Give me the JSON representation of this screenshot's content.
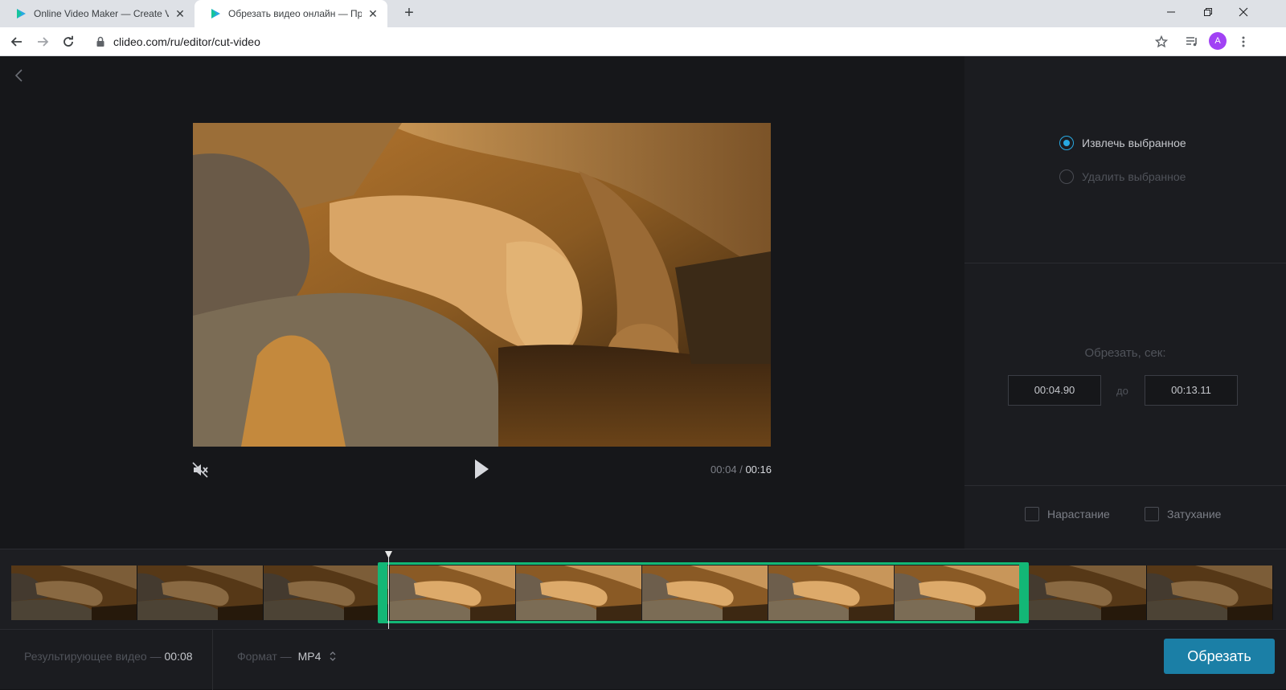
{
  "browser": {
    "tabs": [
      {
        "title": "Online Video Maker — Create Vid",
        "active": false
      },
      {
        "title": "Обрезать видео онлайн — Про",
        "active": true
      }
    ],
    "url": "clideo.com/ru/editor/cut-video",
    "profile_initial": "A",
    "window_controls": [
      "minimize-icon",
      "restore-icon",
      "close-icon"
    ]
  },
  "editor": {
    "player": {
      "current_time": "00:04",
      "separator": "/",
      "total_time": "00:16",
      "muted": true
    },
    "mode_options": [
      {
        "label": "Извлечь выбранное",
        "selected": true
      },
      {
        "label": "Удалить выбранное",
        "selected": false
      }
    ],
    "trim": {
      "label": "Обрезать, сек:",
      "start": "00:04.90",
      "to_label": "до",
      "end": "00:13.11"
    },
    "effects": [
      {
        "label": "Нарастание",
        "checked": false
      },
      {
        "label": "Затухание",
        "checked": false
      }
    ],
    "timeline": {
      "frame_count": 10,
      "selected_frames_from": 3,
      "selected_frames_to": 7
    },
    "bottom": {
      "result_label": "Результирующее видео —",
      "result_value": "00:08",
      "format_label": "Формат —",
      "format_value": "MP4",
      "cut_button": "Обрезать"
    }
  },
  "colors": {
    "accent_blue": "#28a9e2",
    "cut_button": "#1b7fa6",
    "selection_green": "#13b776",
    "background": "#16171a"
  }
}
